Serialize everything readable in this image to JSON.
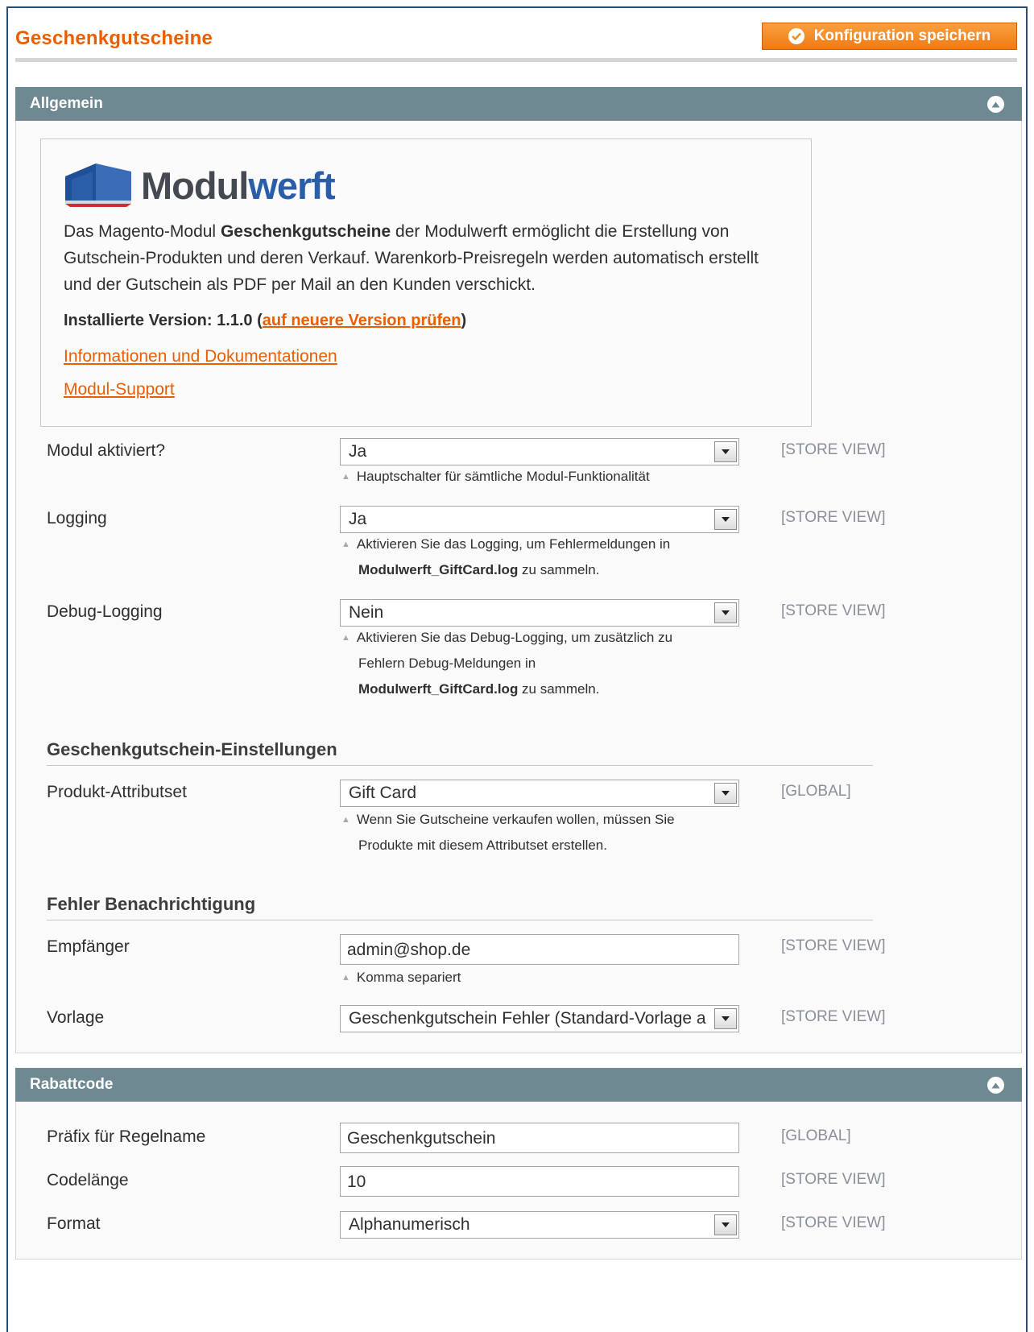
{
  "header": {
    "title": "Geschenkgutscheine",
    "save_label": "Konfiguration speichern"
  },
  "general": {
    "title": "Allgemein",
    "logo": {
      "part1": "Modul",
      "part2": "werft"
    },
    "desc_intro": "Das Magento-Modul ",
    "desc_bold": "Geschenkgutscheine",
    "desc_rest": " der Modulwerft ermöglicht die Erstellung von Gutschein-Produkten und deren Verkauf. Warenkorb-Preisregeln werden automatisch erstellt und der Gutschein als PDF per Mail an den Kunden verschickt.",
    "version_label": "Installierte Version: 1.1.0 (",
    "version_link": "auf neuere Version prüfen",
    "version_close": ")",
    "link_docs": "Informationen und Dokumentationen",
    "link_support": "Modul-Support",
    "fields": {
      "module_active": {
        "label": "Modul aktiviert?",
        "value": "Ja",
        "scope": "[STORE VIEW]",
        "note": "Hauptschalter für sämtliche Modul-Funktionalität"
      },
      "logging": {
        "label": "Logging",
        "value": "Ja",
        "scope": "[STORE VIEW]",
        "note1": "Aktivieren Sie das Logging, um Fehlermeldungen in",
        "note_file": "Modulwerft_GiftCard.log",
        "note2": " zu sammeln."
      },
      "debug_logging": {
        "label": "Debug-Logging",
        "value": "Nein",
        "scope": "[STORE VIEW]",
        "note1": "Aktivieren Sie das Debug-Logging, um zusätzlich zu",
        "note2": "Fehlern Debug-Meldungen in",
        "note_file": "Modulwerft_GiftCard.log",
        "note3": " zu sammeln."
      }
    },
    "giftcard_settings": {
      "heading": "Geschenkgutschein-Einstellungen",
      "attribute_set": {
        "label": "Produkt-Attributset",
        "value": "Gift Card",
        "scope": "[GLOBAL]",
        "note1": "Wenn Sie Gutscheine verkaufen wollen, müssen Sie",
        "note2": "Produkte mit diesem Attributset erstellen."
      }
    },
    "error_notification": {
      "heading": "Fehler Benachrichtigung",
      "recipient": {
        "label": "Empfänger",
        "value": "admin@shop.de",
        "scope": "[STORE VIEW]",
        "note": "Komma separiert"
      },
      "template": {
        "label": "Vorlage",
        "value": "Geschenkgutschein Fehler (Standard-Vorlage a",
        "scope": "[STORE VIEW]"
      }
    }
  },
  "coupon": {
    "title": "Rabattcode",
    "prefix": {
      "label": "Präfix für Regelname",
      "value": "Geschenkgutschein",
      "scope": "[GLOBAL]"
    },
    "length": {
      "label": "Codelänge",
      "value": "10",
      "scope": "[STORE VIEW]"
    },
    "format": {
      "label": "Format",
      "value": "Alphanumerisch",
      "scope": "[STORE VIEW]"
    }
  },
  "colors": {
    "accent": "#eb5e00",
    "section_header": "#6f8992",
    "logo_dark": "#454a52",
    "logo_blue": "#2a5ea8"
  }
}
